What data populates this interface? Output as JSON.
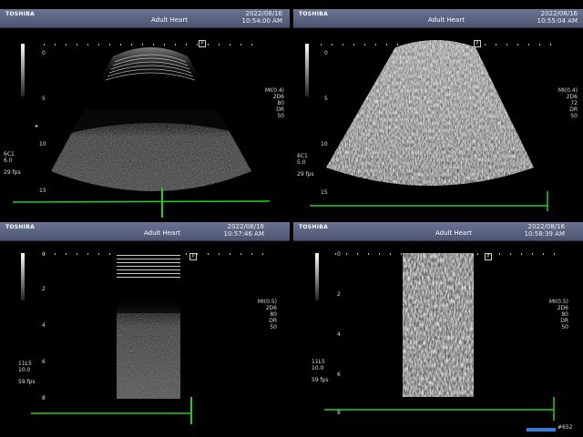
{
  "panels": [
    {
      "brand": "TOSHIBA",
      "preset": "Adult Heart",
      "date": "2022/08/16",
      "time": "10:54:00 AM",
      "ticks": [
        "0",
        "5",
        "10",
        "15"
      ],
      "right_info": [
        "MI(0.4)",
        "2D6",
        "80",
        "DR",
        "50"
      ],
      "left_info": [
        "6C1",
        "6.0",
        "29 fps"
      ]
    },
    {
      "brand": "TOSHIBA",
      "preset": "Adult Heart",
      "date": "2022/08/16",
      "time": "10:55:04 AM",
      "ticks": [
        "0",
        "5",
        "10",
        "15"
      ],
      "right_info": [
        "MI(0.4)",
        "2D6",
        "72",
        "DR",
        "50"
      ],
      "left_info": [
        "6C1",
        "5.0",
        "29 fps"
      ]
    },
    {
      "brand": "TOSHIBA",
      "preset": "Adult Heart",
      "date": "2022/08/16",
      "time": "10:57:46 AM",
      "ticks": [
        "0",
        "2",
        "4",
        "6",
        "8"
      ],
      "right_info": [
        "MI(0.5)",
        "2D6",
        "80",
        "DR",
        "50"
      ],
      "left_info": [
        "11L5",
        "10.0",
        "59 fps"
      ]
    },
    {
      "brand": "TOSHIBA",
      "preset": "Adult Heart",
      "date": "2022/08/16",
      "time": "10:58:39 AM",
      "ticks": [
        "0",
        "2",
        "4",
        "6",
        "8"
      ],
      "right_info": [
        "MI(0.5)",
        "2D6",
        "80",
        "DR",
        "50"
      ],
      "left_info": [
        "11L5",
        "10.0",
        "59 fps"
      ]
    }
  ],
  "footer": {
    "frame": "#652"
  }
}
